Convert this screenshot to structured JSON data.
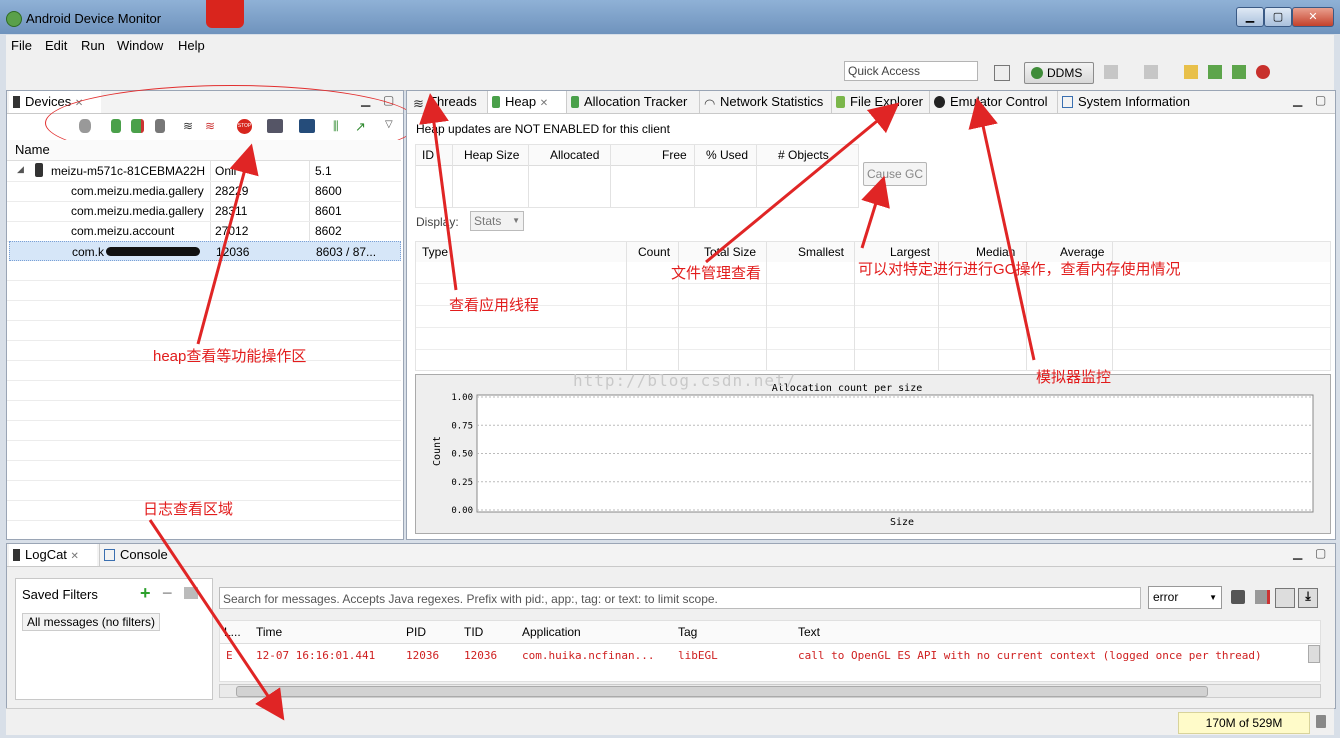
{
  "window": {
    "title": "Android Device Monitor"
  },
  "menu": [
    "File",
    "Edit",
    "Run",
    "Window",
    "Help"
  ],
  "toolbar": {
    "quick_access_placeholder": "Quick Access",
    "perspective": "DDMS"
  },
  "devices": {
    "tab_label": "Devices",
    "columns": [
      "Name",
      "",
      ""
    ],
    "rows": [
      {
        "name": "meizu-m571c-81CEBMA22H",
        "pid": "Onli",
        "port": "5.1"
      },
      {
        "name": "com.meizu.media.gallery",
        "pid": "28229",
        "port": "8600"
      },
      {
        "name": "com.meizu.media.gallery",
        "pid": "28311",
        "port": "8601"
      },
      {
        "name": "com.meizu.account",
        "pid": "27012",
        "port": "8602"
      },
      {
        "name": "com.k",
        "pid": "12036",
        "port": "8603 / 87..."
      }
    ]
  },
  "right_tabs": [
    "Threads",
    "Heap",
    "Allocation Tracker",
    "Network Statistics",
    "File Explorer",
    "Emulator Control",
    "System Information"
  ],
  "heap": {
    "notice": "Heap updates are NOT ENABLED for this client",
    "summary_columns": [
      "ID",
      "Heap Size",
      "Allocated",
      "Free",
      "% Used",
      "# Objects"
    ],
    "cause_gc": "Cause GC",
    "display_label": "Display:",
    "display_value": "Stats",
    "detail_columns": [
      "Type",
      "Count",
      "Total Size",
      "Smallest",
      "Largest",
      "Median",
      "Average"
    ]
  },
  "chart_data": {
    "type": "bar",
    "title": "Allocation count per size",
    "xlabel": "Size",
    "ylabel": "Count",
    "ylim": [
      0,
      1
    ],
    "yticks": [
      "1.00",
      "0.75",
      "0.50",
      "0.25",
      "0.00"
    ],
    "series": []
  },
  "watermark": "http://blog.csdn.net/",
  "annotations": {
    "heap_ops": "heap查看等功能操作区",
    "threads": "查看应用线程",
    "file_mgmt": "文件管理查看",
    "gc_note": "可以对特定进行进行GC操作，查看内存使用情况",
    "emulator": "模拟器监控",
    "log_area": "日志查看区域"
  },
  "logcat": {
    "tabs": [
      "LogCat",
      "Console"
    ],
    "saved_filters_title": "Saved Filters",
    "all_messages": "All messages (no filters)",
    "search_placeholder": "Search for messages. Accepts Java regexes. Prefix with pid:, app:, tag: or text: to limit scope.",
    "level": "error",
    "columns": [
      "L...",
      "Time",
      "PID",
      "TID",
      "Application",
      "Tag",
      "Text"
    ],
    "rows": [
      {
        "level": "E",
        "time": "12-07 16:16:01.441",
        "pid": "12036",
        "tid": "12036",
        "app": "com.huika.ncfinan...",
        "tag": "libEGL",
        "text": "call to OpenGL ES API with no current context (logged once per thread)"
      }
    ]
  },
  "status": {
    "memory": "170M of 529M"
  }
}
